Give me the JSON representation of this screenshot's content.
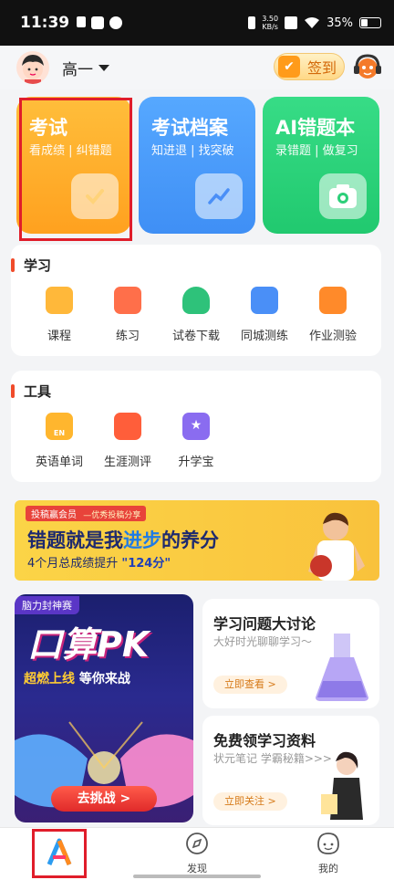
{
  "status_bar": {
    "time": "11:39",
    "net_speed": "3.50",
    "net_unit": "KB/s",
    "battery": "35%"
  },
  "header": {
    "grade": "高一",
    "signin_label": "签到"
  },
  "cards": [
    {
      "title": "考试",
      "subtitle": "看成绩 | 纠错题"
    },
    {
      "title": "考试档案",
      "subtitle": "知进退 | 找突破"
    },
    {
      "title": "AI错题本",
      "subtitle": "录错题 | 做复习"
    }
  ],
  "study": {
    "title": "学习",
    "items": [
      {
        "label": "课程",
        "icon": "course-icon",
        "color": "#ffa726"
      },
      {
        "label": "练习",
        "icon": "practice-icon",
        "color": "#ff6f4a"
      },
      {
        "label": "试卷下载",
        "icon": "download-icon",
        "color": "#2ec27a"
      },
      {
        "label": "同城测练",
        "icon": "city-test-icon",
        "color": "#4a8ff7"
      },
      {
        "label": "作业测验",
        "icon": "homework-icon",
        "color": "#ff8a2a"
      }
    ]
  },
  "tools": {
    "title": "工具",
    "items": [
      {
        "label": "英语单词",
        "icon": "english-words-icon",
        "color": "#ffb62e",
        "badge": "EN"
      },
      {
        "label": "生涯测评",
        "icon": "career-assessment-icon",
        "color": "#ff5e3a"
      },
      {
        "label": "升学宝",
        "icon": "admission-icon",
        "color": "#8a6cf0"
      }
    ]
  },
  "banner": {
    "tag": "投稿赢会员",
    "tag_sub": "—优秀投稿分享",
    "title_pre": "错题就是我",
    "title_em": "进步",
    "title_post": "的养分",
    "sub_pre": "4个月总成绩提升",
    "sub_value": "\"124分\""
  },
  "promo": {
    "tag": "脑力封神赛",
    "title": "口算PK",
    "sub_a": "超燃上线",
    "sub_b": " 等你来战",
    "button": "去挑战 >"
  },
  "side_cards": [
    {
      "title": "学习问题大讨论",
      "subtitle": "大好时光聊聊学习～",
      "button": "立即查看 >"
    },
    {
      "title": "免费领学习资料",
      "subtitle": "状元笔记 学霸秘籍>>>",
      "button": "立即关注 >"
    }
  ],
  "nav": {
    "discover": "发现",
    "mine": "我的"
  }
}
